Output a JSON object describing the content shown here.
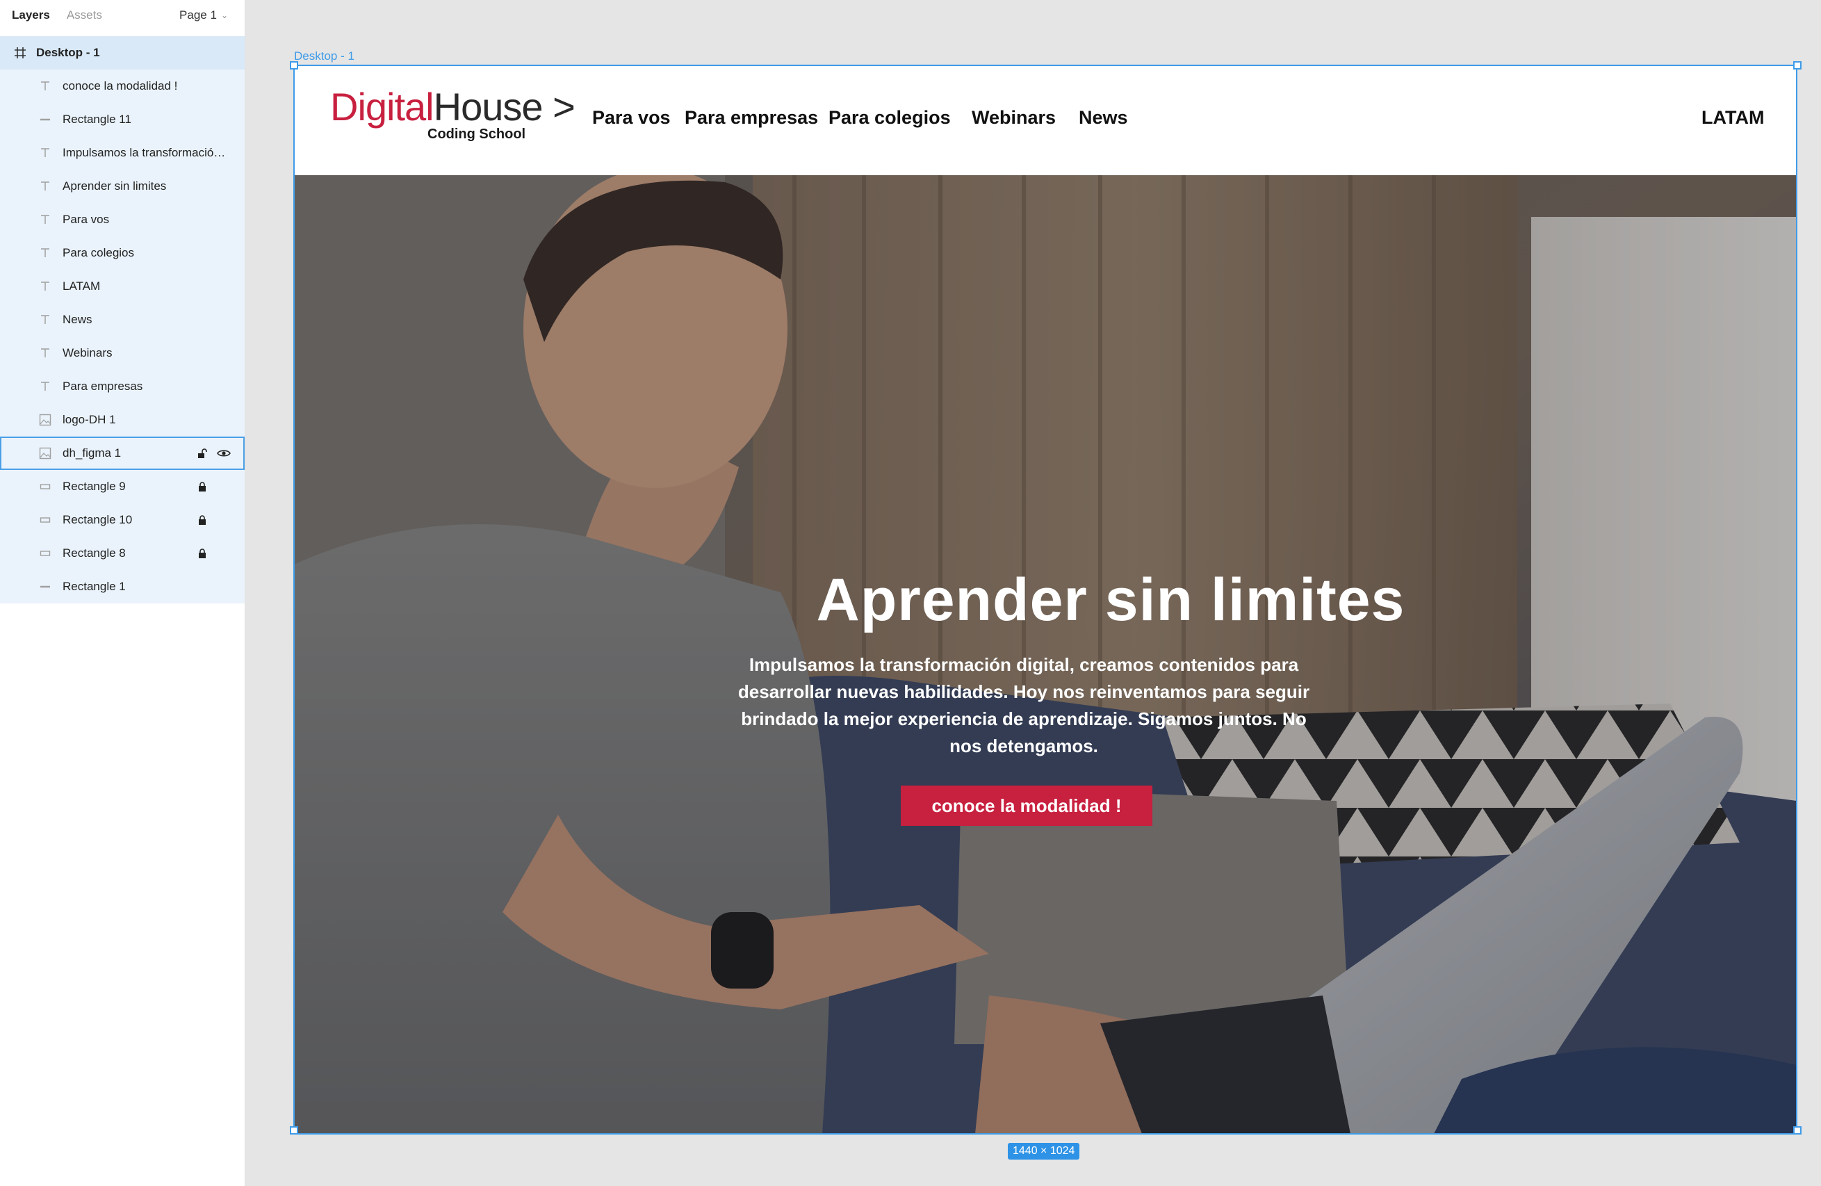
{
  "panel": {
    "tab_layers": "Layers",
    "tab_assets": "Assets",
    "page_label": "Page 1"
  },
  "layers": [
    {
      "name": "Desktop - 1",
      "icon": "frame-icon"
    },
    {
      "name": "conoce la modalidad !",
      "icon": "text-layer-icon"
    },
    {
      "name": "Rectangle 11",
      "icon": "line-layer-icon"
    },
    {
      "name": "Impulsamos la transformació…",
      "icon": "text-layer-icon"
    },
    {
      "name": "Aprender sin limites",
      "icon": "text-layer-icon"
    },
    {
      "name": "Para vos",
      "icon": "text-layer-icon"
    },
    {
      "name": "Para colegios",
      "icon": "text-layer-icon"
    },
    {
      "name": "LATAM",
      "icon": "text-layer-icon"
    },
    {
      "name": "News",
      "icon": "text-layer-icon"
    },
    {
      "name": "Webinars",
      "icon": "text-layer-icon"
    },
    {
      "name": "Para empresas",
      "icon": "text-layer-icon"
    },
    {
      "name": "logo-DH 1",
      "icon": "image-layer-icon"
    },
    {
      "name": "dh_figma 1",
      "icon": "image-layer-icon",
      "unlock_icon": "unlock-icon",
      "eye_icon": "eye-icon"
    },
    {
      "name": "Rectangle 9",
      "icon": "rectangle-layer-icon",
      "lock_icon": "lock-icon"
    },
    {
      "name": "Rectangle 10",
      "icon": "rectangle-layer-icon",
      "lock_icon": "lock-icon"
    },
    {
      "name": "Rectangle 8",
      "icon": "rectangle-layer-icon",
      "lock_icon": "lock-icon"
    },
    {
      "name": "Rectangle 1",
      "icon": "line-layer-icon"
    }
  ],
  "canvas": {
    "frame_label": "Desktop - 1",
    "dimensions": "1440 × 1024",
    "selection_color": "#3f9be8"
  },
  "site": {
    "logo": {
      "digital": "Digital",
      "house": "House",
      "arrow": ">",
      "sub": "Coding School"
    },
    "nav": {
      "para_vos": "Para vos",
      "para_empresas": "Para empresas",
      "para_colegios": "Para colegios",
      "webinars": "Webinars",
      "news": "News",
      "latam": "LATAM"
    },
    "hero": {
      "title": "Aprender sin limites",
      "body": "Impulsamos la transformación digital, creamos contenidos para desarrollar nuevas habilidades. Hoy nos reinventamos para seguir brindado la mejor experiencia de aprendizaje. Sigamos juntos. No nos detengamos.",
      "cta": "conoce la modalidad !"
    },
    "colors": {
      "brand_red": "#c8203f",
      "text_dark": "#111111"
    }
  }
}
